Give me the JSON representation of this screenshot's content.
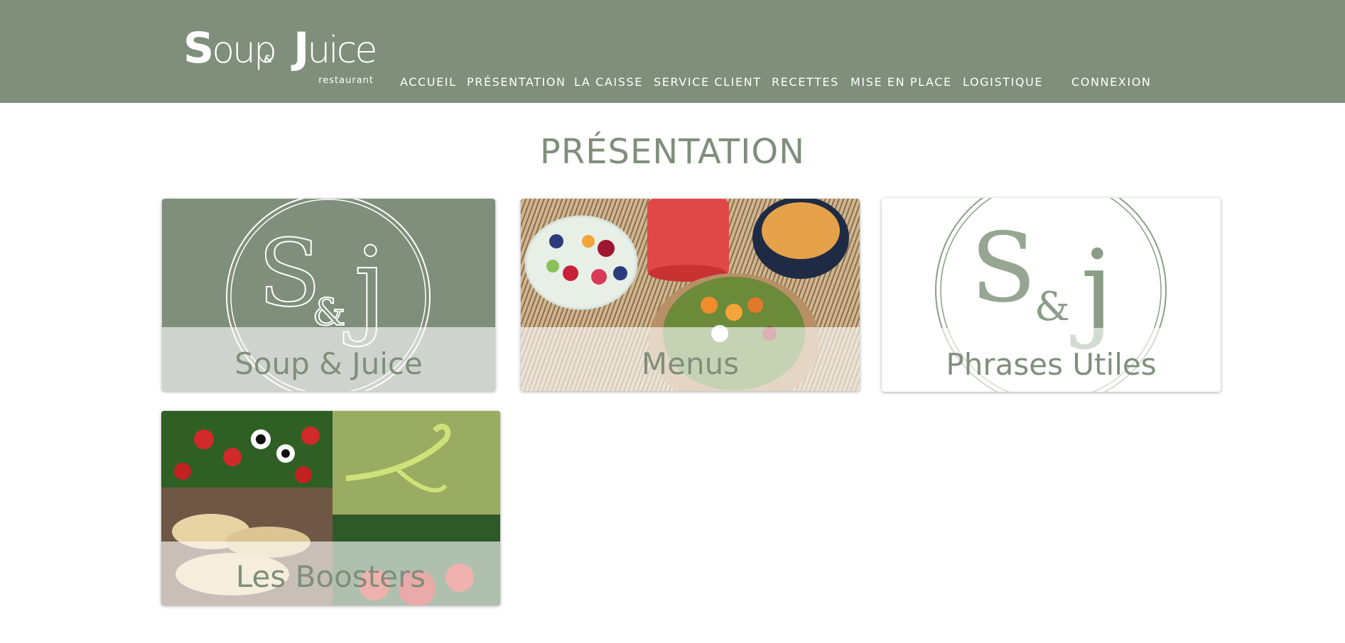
{
  "brand": {
    "logo_text_main": "Soup Juice",
    "logo_amp": "&",
    "logo_sub": "restaurant"
  },
  "nav": {
    "items": [
      {
        "label": "ACCUEIL"
      },
      {
        "label": "PRÉSENTATION"
      },
      {
        "label": "LA CAISSE"
      },
      {
        "label": "SERVICE CLIENT"
      },
      {
        "label": "RECETTES"
      },
      {
        "label": "MISE EN PLACE"
      },
      {
        "label": "LOGISTIQUE"
      },
      {
        "label": "CONNEXION"
      }
    ]
  },
  "page": {
    "title": "PRÉSENTATION"
  },
  "cards": [
    {
      "label": "Soup & Juice",
      "image": "soup-juice-logo-green"
    },
    {
      "label": "Menus",
      "image": "food-bowls-photo"
    },
    {
      "label": "Phrases Utiles",
      "image": "soup-juice-logo-white"
    },
    {
      "label": "Les Boosters",
      "image": "boosters-collage-photo"
    }
  ],
  "colors": {
    "header_bg": "#7f8f7b",
    "accent": "#7f8f7b",
    "text_light": "#ffffff"
  }
}
